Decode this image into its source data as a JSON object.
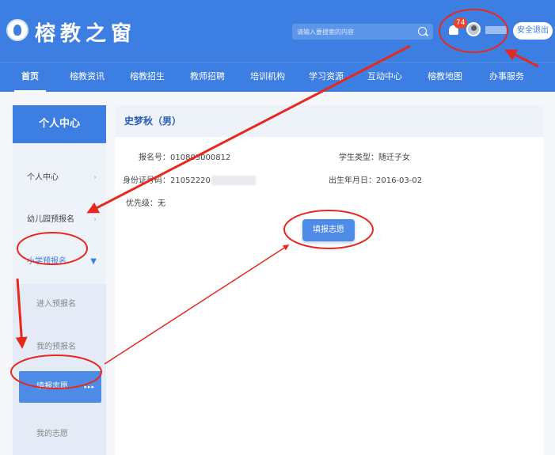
{
  "header": {
    "logo_text": "榕教之窗",
    "search_placeholder": "请输入要搜索的内容",
    "notification_count": "74",
    "logout_label": "安全退出"
  },
  "nav": {
    "items": [
      "首页",
      "榕教资讯",
      "榕教招生",
      "教师招聘",
      "培训机构",
      "学习资源",
      "互动中心",
      "榕教地图",
      "办事服务"
    ]
  },
  "sidebar": {
    "title": "个人中心",
    "items": [
      {
        "label": "个人中心",
        "chevron": "›"
      },
      {
        "label": "幼儿园预报名",
        "chevron": "›"
      },
      {
        "label": "小学预报名",
        "chevron": "▼"
      }
    ],
    "sub_items": [
      "进入预报名",
      "我的预报名",
      "填报志愿",
      "我的志愿"
    ],
    "active_arrows": "▸▸▸"
  },
  "main": {
    "student_name": "史梦秋（男）",
    "reg_no": "报名号：010803000812",
    "student_type": "学生类型：随迁子女",
    "id_no": "身份证号码：21052220",
    "birth_date": "出生年月日：2016-03-02",
    "priority": "优先级：无",
    "apply_button": "填报志愿"
  },
  "colors": {
    "primary": "#3d7ee2",
    "annotation": "#e8281e"
  }
}
